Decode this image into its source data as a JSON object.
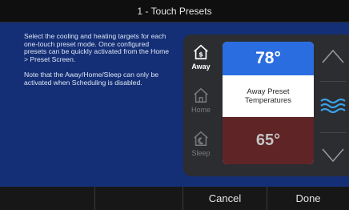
{
  "header": {
    "title": "1 - Touch Presets"
  },
  "description": {
    "para1": "Select the cooling and heating targets for each one-touch preset mode. Once configured presets can be quickly activated from the Home > Preset Screen.",
    "para2": "Note that the Away/Home/Sleep can only be activated when Scheduling is disabled."
  },
  "modes": [
    {
      "label": "Away",
      "icon": "away-house-dollar-icon",
      "active": true
    },
    {
      "label": "Home",
      "icon": "home-house-icon",
      "active": false
    },
    {
      "label": "Sleep",
      "icon": "sleep-house-moon-icon",
      "active": false
    }
  ],
  "preset": {
    "cool_temp": "78°",
    "title": "Away Preset",
    "subtitle": "Temperatures",
    "heat_temp": "65°"
  },
  "controls": {
    "up_icon": "chevron-up-icon",
    "fan_icon": "fan-waves-icon",
    "down_icon": "chevron-down-icon"
  },
  "footer": {
    "btn1": "",
    "btn2": "",
    "cancel": "Cancel",
    "done": "Done"
  },
  "colors": {
    "background": "#142f75",
    "cool": "#2a6de0",
    "heat": "#5e2426",
    "accent": "#3aa0e8"
  }
}
